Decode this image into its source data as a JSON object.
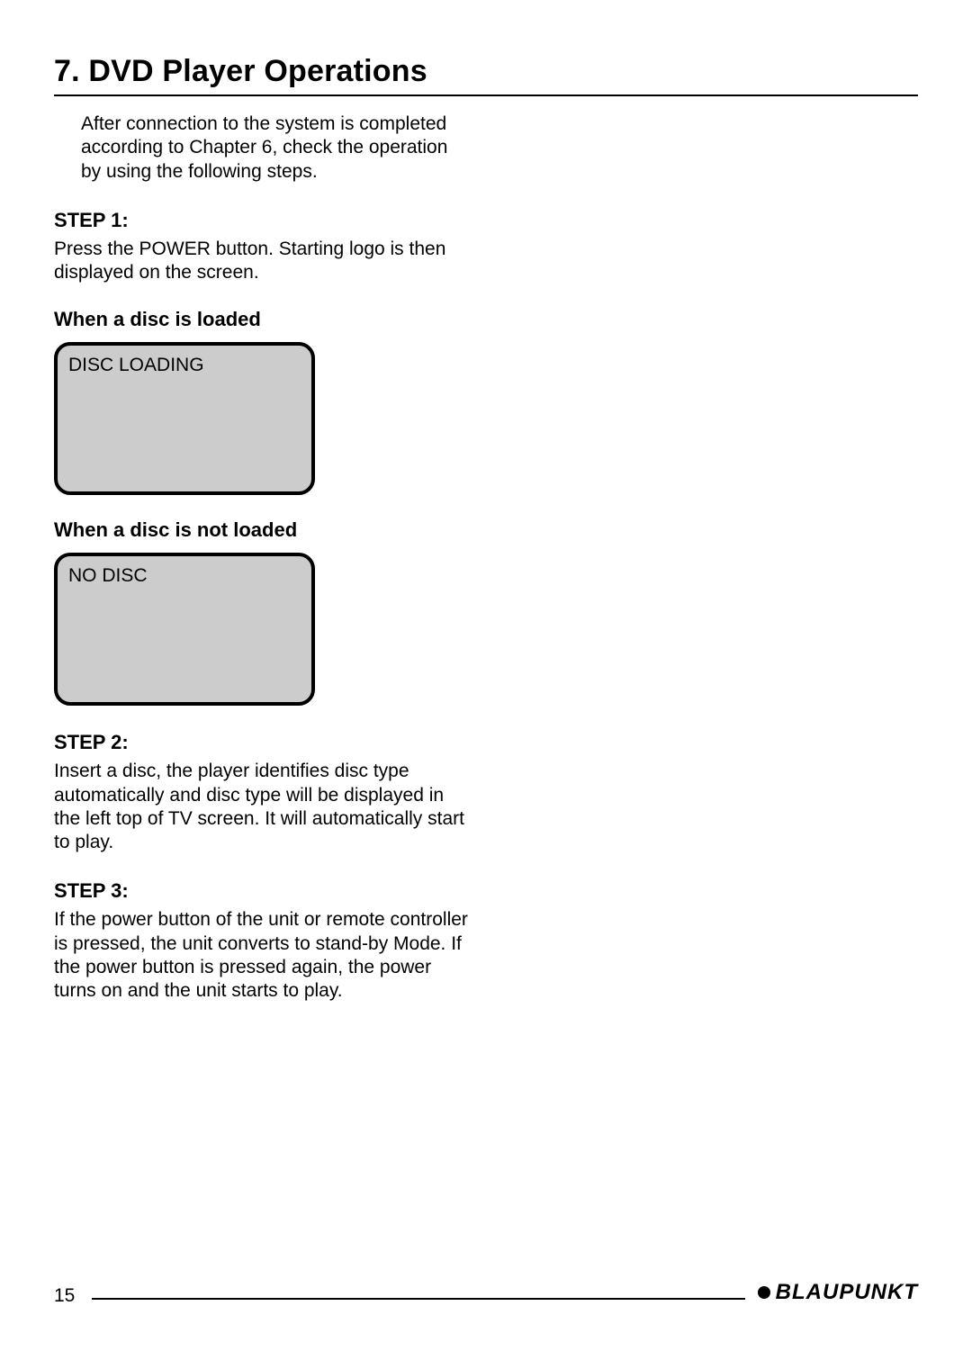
{
  "section": {
    "title": "7. DVD Player Operations",
    "intro": "After connection to the system is completed according to Chapter 6, check the operation by using the following steps."
  },
  "steps": {
    "s1": {
      "heading": "STEP 1:",
      "body": "Press the POWER button. Starting logo is then displayed on the screen."
    },
    "s2": {
      "heading": "STEP 2:",
      "body": "Insert a disc, the player identifies disc type automatically and disc type will be displayed in the left top of TV screen.  It will automatically start to play."
    },
    "s3": {
      "heading": "STEP 3:",
      "body": "If the power button of the unit or remote controller is pressed, the unit converts to stand-by Mode. If the power button is pressed again, the power turns on and the unit starts to play."
    }
  },
  "screens": {
    "loaded": {
      "heading": "When a disc is loaded",
      "text": "DISC LOADING"
    },
    "not_loaded": {
      "heading": "When a disc is not loaded",
      "text": "NO DISC"
    }
  },
  "footer": {
    "page_num": "15",
    "brand": "BLAUPUNKT"
  }
}
